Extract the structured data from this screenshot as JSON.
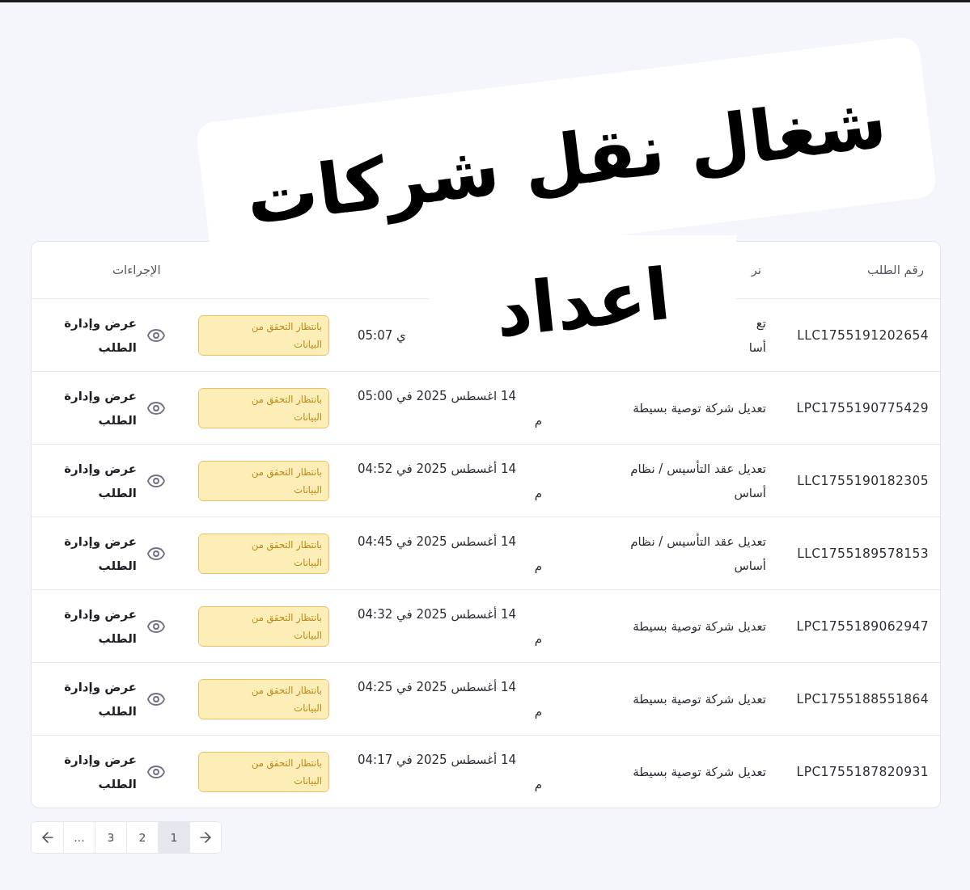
{
  "sticker": {
    "lines": [
      "شغال نقل شركات",
      "اعداد"
    ]
  },
  "table": {
    "header": {
      "request_number": "رقم الطلب",
      "type": "نر",
      "actions": "الإجراءات"
    },
    "rows": [
      {
        "request_number": "LLC1755191202654",
        "type": "تع\nأسا",
        "date": "ي 05:07",
        "status": "بانتظار التحقق من البيانات",
        "action": "عرض وإدارة الطلب"
      },
      {
        "request_number": "LPC1755190775429",
        "type": "تعديل شركة توصية بسيطة",
        "date": "14 اغسطس 2025 في 05:00\nم",
        "status": "بانتظار التحقق من البيانات",
        "action": "عرض وإدارة الطلب"
      },
      {
        "request_number": "LLC1755190182305",
        "type": "تعديل عقد التأسيس / نظام\nأساس",
        "date": "14 أغسطس 2025 في 04:52\nم",
        "status": "بانتظار التحقق من البيانات",
        "action": "عرض وإدارة الطلب"
      },
      {
        "request_number": "LLC1755189578153",
        "type": "تعديل عقد التأسيس / نظام\nأساس",
        "date": "14 أغسطس 2025 في 04:45\nم",
        "status": "بانتظار التحقق من البيانات",
        "action": "عرض وإدارة الطلب"
      },
      {
        "request_number": "LPC1755189062947",
        "type": "تعديل شركة توصية بسيطة",
        "date": "14 أغسطس 2025 في 04:32\nم",
        "status": "بانتظار التحقق من البيانات",
        "action": "عرض وإدارة الطلب"
      },
      {
        "request_number": "LPC1755188551864",
        "type": "تعديل شركة توصية بسيطة",
        "date": "14 أغسطس 2025 في 04:25\nم",
        "status": "بانتظار التحقق من البيانات",
        "action": "عرض وإدارة الطلب"
      },
      {
        "request_number": "LPC1755187820931",
        "type": "تعديل شركة توصية بسيطة",
        "date": "14 أغسطس 2025 في 04:17\nم",
        "status": "بانتظار التحقق من البيانات",
        "action": "عرض وإدارة الطلب"
      }
    ]
  },
  "pagination": [
    {
      "kind": "prev"
    },
    {
      "kind": "page",
      "label": "1",
      "selected": true
    },
    {
      "kind": "page",
      "label": "2",
      "selected": false
    },
    {
      "kind": "page",
      "label": "3",
      "selected": false
    },
    {
      "kind": "ellipsis",
      "label": "..."
    },
    {
      "kind": "next"
    }
  ]
}
